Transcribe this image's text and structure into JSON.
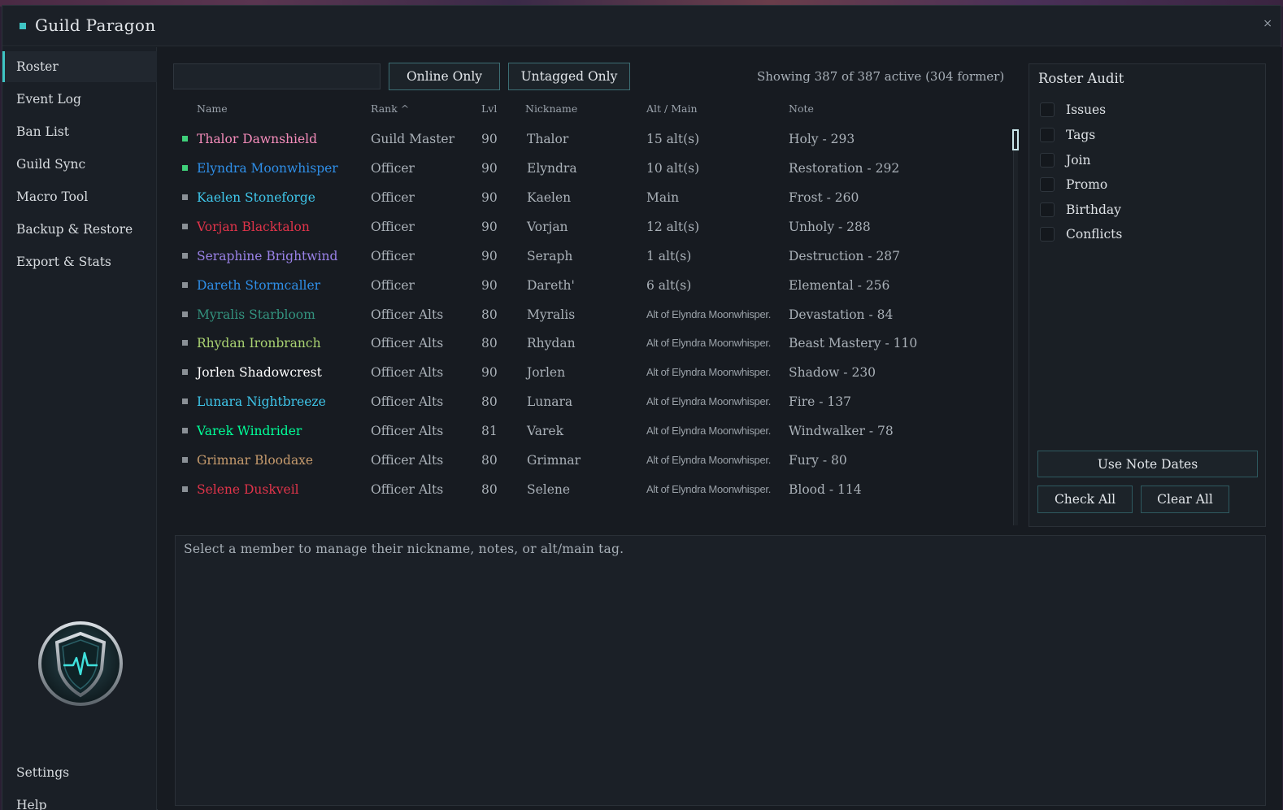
{
  "app": {
    "title": "Guild Paragon",
    "close_label": "×"
  },
  "sidebar": {
    "items": [
      {
        "label": "Roster",
        "active": true
      },
      {
        "label": "Event Log"
      },
      {
        "label": "Ban List"
      },
      {
        "label": "Guild Sync"
      },
      {
        "label": "Macro Tool"
      },
      {
        "label": "Backup & Restore"
      },
      {
        "label": "Export & Stats"
      }
    ],
    "bottom_items": [
      {
        "label": "Settings"
      },
      {
        "label": "Help"
      }
    ],
    "logo_icon": "shield-heartbeat-icon"
  },
  "toolbar": {
    "search_value": "",
    "online_only_label": "Online Only",
    "untagged_only_label": "Untagged Only",
    "showing_text": "Showing 387 of 387 active (304 former)"
  },
  "table": {
    "headers": [
      "Name",
      "Rank ^",
      "Lvl",
      "Nickname",
      "Alt / Main",
      "Note"
    ],
    "rows": [
      {
        "name": "Thalor Dawnshield",
        "name_color": "#f48cba",
        "online": true,
        "rank": "Guild Master",
        "lvl": "90",
        "nickname": "Thalor",
        "altmain": "15 alt(s)",
        "note": "Holy - 293"
      },
      {
        "name": "Elyndra Moonwhisper",
        "name_color": "#2f8fe8",
        "online": true,
        "rank": "Officer",
        "lvl": "90",
        "nickname": "Elyndra",
        "altmain": "10 alt(s)",
        "note": "Restoration - 292"
      },
      {
        "name": "Kaelen Stoneforge",
        "name_color": "#3fc7eb",
        "online": false,
        "rank": "Officer",
        "lvl": "90",
        "nickname": "Kaelen",
        "altmain": "Main",
        "note": "Frost - 260"
      },
      {
        "name": "Vorjan Blacktalon",
        "name_color": "#e0344a",
        "online": false,
        "rank": "Officer",
        "lvl": "90",
        "nickname": "Vorjan",
        "altmain": "12 alt(s)",
        "note": "Unholy - 288"
      },
      {
        "name": "Seraphine Brightwind",
        "name_color": "#9a82e8",
        "online": false,
        "rank": "Officer",
        "lvl": "90",
        "nickname": "Seraph",
        "altmain": "1 alt(s)",
        "note": "Destruction - 287"
      },
      {
        "name": "Dareth Stormcaller",
        "name_color": "#2f8fe8",
        "online": false,
        "rank": "Officer",
        "lvl": "90",
        "nickname": "Dareth'",
        "altmain": "6 alt(s)",
        "note": "Elemental - 256"
      },
      {
        "name": "Myralis Starbloom",
        "name_color": "#33937f",
        "online": false,
        "rank": "Officer Alts",
        "lvl": "80",
        "nickname": "Myralis",
        "altmain": "Alt of Elyndra Moonwhisper.",
        "note": "Devastation - 84"
      },
      {
        "name": "Rhydan Ironbranch",
        "name_color": "#aad372",
        "online": false,
        "rank": "Officer Alts",
        "lvl": "80",
        "nickname": "Rhydan",
        "altmain": "Alt of Elyndra Moonwhisper.",
        "note": "Beast Mastery - 110"
      },
      {
        "name": "Jorlen Shadowcrest",
        "name_color": "#ffffff",
        "online": false,
        "rank": "Officer Alts",
        "lvl": "90",
        "nickname": "Jorlen",
        "altmain": "Alt of Elyndra Moonwhisper.",
        "note": "Shadow - 230"
      },
      {
        "name": "Lunara Nightbreeze",
        "name_color": "#3fc7eb",
        "online": false,
        "rank": "Officer Alts",
        "lvl": "80",
        "nickname": "Lunara",
        "altmain": "Alt of Elyndra Moonwhisper.",
        "note": "Fire - 137"
      },
      {
        "name": "Varek Windrider",
        "name_color": "#00ff98",
        "online": false,
        "rank": "Officer Alts",
        "lvl": "81",
        "nickname": "Varek",
        "altmain": "Alt of Elyndra Moonwhisper.",
        "note": "Windwalker - 78"
      },
      {
        "name": "Grimnar Bloodaxe",
        "name_color": "#c69b6d",
        "online": false,
        "rank": "Officer Alts",
        "lvl": "80",
        "nickname": "Grimnar",
        "altmain": "Alt of Elyndra Moonwhisper.",
        "note": "Fury - 80"
      },
      {
        "name": "Selene Duskveil",
        "name_color": "#e0344a",
        "online": false,
        "rank": "Officer Alts",
        "lvl": "80",
        "nickname": "Selene",
        "altmain": "Alt of Elyndra Moonwhisper.",
        "note": "Blood - 114"
      }
    ]
  },
  "audit": {
    "title": "Roster Audit",
    "checks": [
      {
        "label": "Issues",
        "checked": false
      },
      {
        "label": "Tags",
        "checked": false
      },
      {
        "label": "Join",
        "checked": false
      },
      {
        "label": "Promo",
        "checked": false
      },
      {
        "label": "Birthday",
        "checked": false
      },
      {
        "label": "Conflicts",
        "checked": false
      }
    ],
    "use_note_dates_label": "Use Note Dates",
    "check_all_label": "Check All",
    "clear_all_label": "Clear All"
  },
  "detail": {
    "placeholder_text": "Select a member to manage their nickname, notes, or alt/main tag."
  },
  "colors": {
    "accent": "#3fc4c4",
    "online_status": "#3fd07a",
    "offline_status": "#8a9096"
  }
}
